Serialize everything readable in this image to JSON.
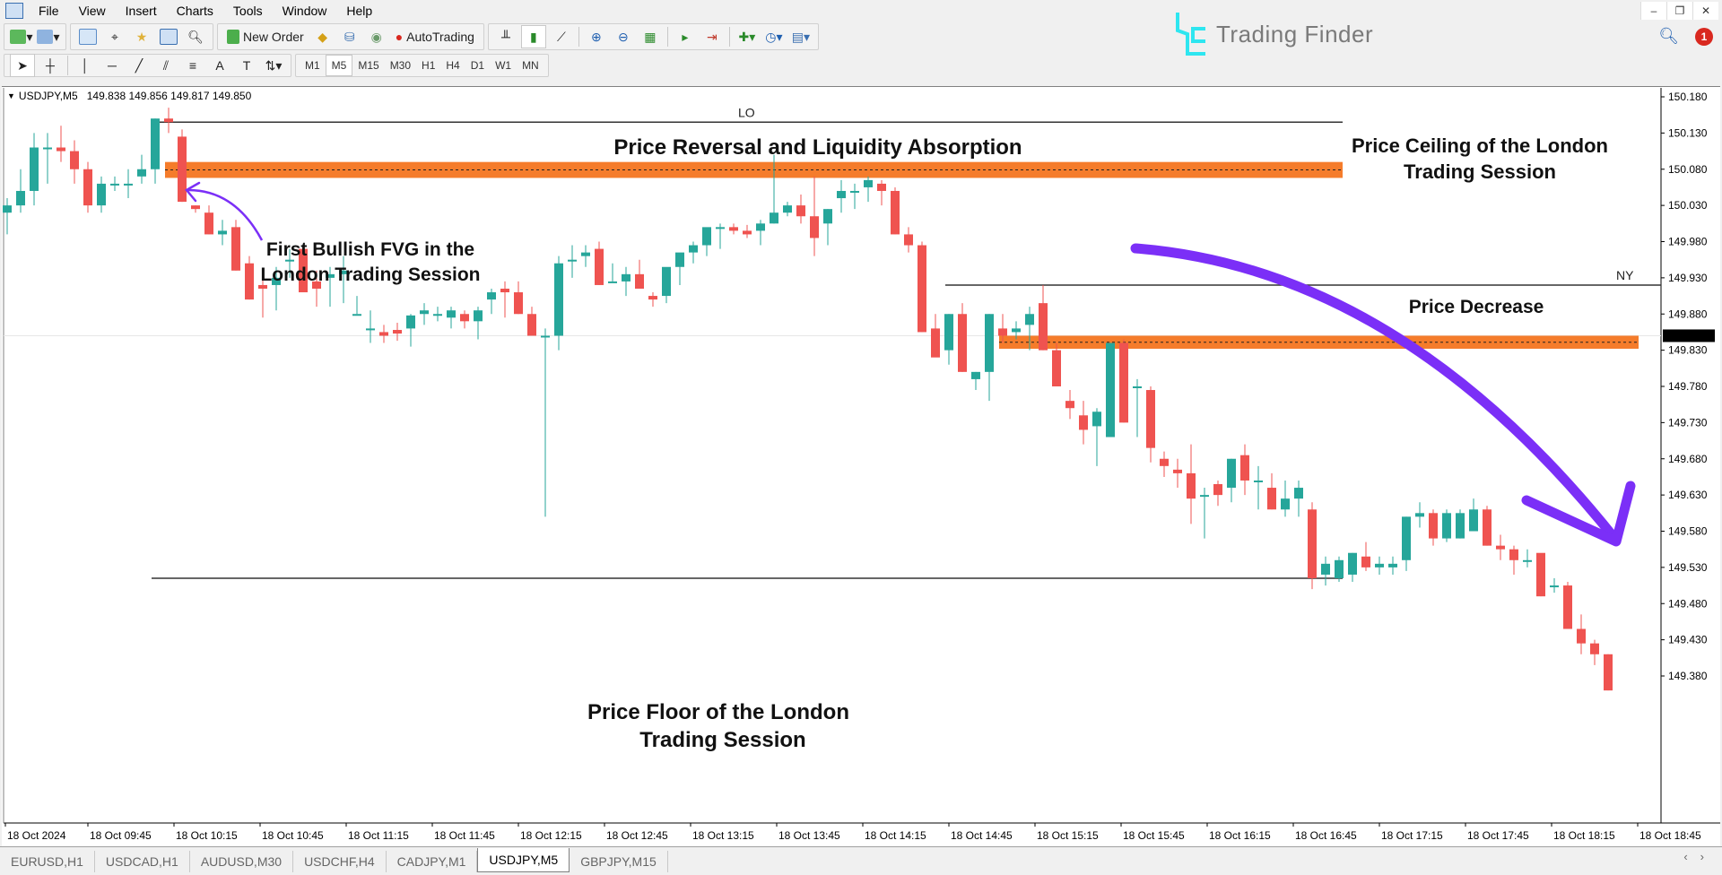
{
  "menu": {
    "items": [
      "File",
      "View",
      "Insert",
      "Charts",
      "Tools",
      "Window",
      "Help"
    ]
  },
  "window_controls": [
    "minimize-icon",
    "restore-icon",
    "close-icon"
  ],
  "toolbar": {
    "new_order_label": "New Order",
    "autotrading_label": "AutoTrading",
    "icons": [
      "new-chart-icon",
      "profiles-icon",
      "market-watch-icon",
      "data-window-icon",
      "navigator-icon",
      "terminal-icon",
      "strategy-tester-icon",
      "new-order-icon",
      "metaeditor-icon",
      "signals-icon",
      "vps-icon",
      "autotrading-icon",
      "bar-chart-icon",
      "candlestick-icon",
      "line-chart-icon",
      "zoom-in-icon",
      "zoom-out-icon",
      "tile-windows-icon",
      "auto-scroll-icon",
      "chart-shift-icon",
      "indicators-icon",
      "periods-icon",
      "templates-icon"
    ]
  },
  "drawing_toolbar": {
    "tools": [
      "cursor-icon",
      "crosshair-icon",
      "vertical-line-icon",
      "horizontal-line-icon",
      "trendline-icon",
      "equidistant-channel-icon",
      "fibonacci-icon",
      "text-icon",
      "text-label-icon",
      "arrows-icon"
    ],
    "timeframes": [
      "M1",
      "M5",
      "M15",
      "M30",
      "H1",
      "H4",
      "D1",
      "W1",
      "MN"
    ],
    "active_timeframe": "M5"
  },
  "branding": {
    "logo_text": "Trading Finder"
  },
  "notifications": {
    "count": "1"
  },
  "chart_header": {
    "symbol": "USDJPY,M5",
    "ohlc": "149.838 149.856 149.817 149.850"
  },
  "tabs": [
    {
      "label": "EURUSD,H1",
      "active": false
    },
    {
      "label": "USDCAD,H1",
      "active": false
    },
    {
      "label": "AUDUSD,M30",
      "active": false
    },
    {
      "label": "USDCHF,H4",
      "active": false
    },
    {
      "label": "CADJPY,M1",
      "active": false
    },
    {
      "label": "USDJPY,M5",
      "active": true
    },
    {
      "label": "GBPJPY,M15",
      "active": false
    }
  ],
  "colors": {
    "bull": "#26a69a",
    "bear": "#ef5350",
    "fvg_zone": "#f57c2b",
    "arrow": "#7b2ff7",
    "session_line": "#333333"
  },
  "chart_data": {
    "type": "candlestick",
    "symbol": "USDJPY",
    "timeframe": "M5",
    "ylim": [
      149.36,
      150.195
    ],
    "y_ticks": [
      "150.180",
      "150.130",
      "150.080",
      "150.030",
      "149.980",
      "149.930",
      "149.880",
      "149.830",
      "149.780",
      "149.730",
      "149.680",
      "149.630",
      "149.580",
      "149.530",
      "149.480",
      "149.430",
      "149.380"
    ],
    "current_price": "149.850",
    "x_ticks": [
      "18 Oct 2024",
      "18 Oct 09:45",
      "18 Oct 10:15",
      "18 Oct 10:45",
      "18 Oct 11:15",
      "18 Oct 11:45",
      "18 Oct 12:15",
      "18 Oct 12:45",
      "18 Oct 13:15",
      "18 Oct 13:45",
      "18 Oct 14:15",
      "18 Oct 14:45",
      "18 Oct 15:15",
      "18 Oct 15:45",
      "18 Oct 16:15",
      "18 Oct 16:45",
      "18 Oct 17:15",
      "18 Oct 17:45",
      "18 Oct 18:15",
      "18 Oct 18:45"
    ],
    "candles": [
      [
        150.02,
        150.04,
        149.99,
        150.03
      ],
      [
        150.03,
        150.08,
        150.02,
        150.05
      ],
      [
        150.05,
        150.13,
        150.03,
        150.11
      ],
      [
        150.11,
        150.13,
        150.06,
        150.11
      ],
      [
        150.11,
        150.14,
        150.09,
        150.105
      ],
      [
        150.105,
        150.12,
        150.06,
        150.08
      ],
      [
        150.08,
        150.09,
        150.02,
        150.03
      ],
      [
        150.03,
        150.07,
        150.02,
        150.06
      ],
      [
        150.06,
        150.07,
        150.05,
        150.06
      ],
      [
        150.06,
        150.08,
        150.04,
        150.06
      ],
      [
        150.07,
        150.1,
        150.06,
        150.08
      ],
      [
        150.08,
        150.15,
        150.06,
        150.15
      ],
      [
        150.15,
        150.165,
        150.13,
        150.145
      ],
      [
        150.125,
        150.135,
        150.035,
        150.035
      ],
      [
        150.03,
        150.03,
        150.02,
        150.025
      ],
      [
        150.02,
        150.03,
        149.99,
        149.99
      ],
      [
        149.99,
        150.01,
        149.975,
        149.995
      ],
      [
        150.0,
        150.01,
        149.94,
        149.94
      ],
      [
        149.95,
        149.96,
        149.9,
        149.9
      ],
      [
        149.92,
        149.935,
        149.875,
        149.915
      ],
      [
        149.92,
        149.945,
        149.885,
        149.93
      ],
      [
        149.955,
        149.97,
        149.93,
        149.955
      ],
      [
        149.97,
        149.975,
        149.91,
        149.91
      ],
      [
        149.925,
        149.94,
        149.89,
        149.915
      ],
      [
        149.93,
        149.945,
        149.89,
        149.935
      ],
      [
        149.935,
        149.96,
        149.895,
        149.94
      ],
      [
        149.88,
        149.905,
        149.88,
        149.88
      ],
      [
        149.86,
        149.885,
        149.84,
        149.86
      ],
      [
        149.855,
        149.865,
        149.84,
        149.85
      ],
      [
        149.858,
        149.868,
        149.843,
        149.853
      ],
      [
        149.86,
        149.88,
        149.835,
        149.878
      ],
      [
        149.88,
        149.895,
        149.865,
        149.885
      ],
      [
        149.88,
        149.89,
        149.87,
        149.88
      ],
      [
        149.875,
        149.89,
        149.86,
        149.885
      ],
      [
        149.88,
        149.885,
        149.86,
        149.87
      ],
      [
        149.87,
        149.89,
        149.845,
        149.885
      ],
      [
        149.9,
        149.915,
        149.88,
        149.91
      ],
      [
        149.915,
        149.925,
        149.875,
        149.91
      ],
      [
        149.91,
        149.925,
        149.88,
        149.88
      ],
      [
        149.88,
        149.89,
        149.855,
        149.85
      ],
      [
        149.85,
        149.86,
        149.6,
        149.85
      ],
      [
        149.85,
        149.96,
        149.83,
        149.95
      ],
      [
        149.955,
        149.975,
        149.93,
        149.955
      ],
      [
        149.96,
        149.975,
        149.945,
        149.965
      ],
      [
        149.97,
        149.98,
        149.92,
        149.92
      ],
      [
        149.925,
        149.95,
        149.925,
        149.925
      ],
      [
        149.925,
        149.945,
        149.905,
        149.935
      ],
      [
        149.935,
        149.955,
        149.915,
        149.915
      ],
      [
        149.905,
        149.91,
        149.89,
        149.9
      ],
      [
        149.905,
        149.93,
        149.895,
        149.945
      ],
      [
        149.945,
        149.96,
        149.92,
        149.965
      ],
      [
        149.965,
        149.98,
        149.95,
        149.975
      ],
      [
        149.975,
        149.99,
        149.96,
        150.0
      ],
      [
        150.0,
        150.005,
        149.97,
        150.0
      ],
      [
        150.0,
        150.005,
        149.99,
        149.995
      ],
      [
        149.995,
        150.003,
        149.985,
        149.99
      ],
      [
        149.995,
        150.01,
        149.975,
        150.005
      ],
      [
        150.005,
        150.1,
        150.005,
        150.02
      ],
      [
        150.02,
        150.035,
        150.015,
        150.03
      ],
      [
        150.03,
        150.045,
        150.005,
        150.015
      ],
      [
        150.015,
        150.07,
        149.96,
        149.985
      ],
      [
        150.005,
        150.025,
        149.975,
        150.025
      ],
      [
        150.04,
        150.065,
        150.02,
        150.05
      ],
      [
        150.05,
        150.06,
        150.025,
        150.05
      ],
      [
        150.055,
        150.07,
        150.035,
        150.065
      ],
      [
        150.06,
        150.065,
        150.03,
        150.05
      ],
      [
        150.05,
        150.055,
        149.99,
        149.99
      ],
      [
        149.99,
        150.0,
        149.965,
        149.975
      ],
      [
        149.975,
        149.98,
        149.855,
        149.855
      ],
      [
        149.86,
        149.88,
        149.825,
        149.82
      ],
      [
        149.83,
        149.88,
        149.81,
        149.88
      ],
      [
        149.88,
        149.895,
        149.8,
        149.8
      ],
      [
        149.79,
        149.8,
        149.775,
        149.8
      ],
      [
        149.8,
        149.88,
        149.76,
        149.88
      ],
      [
        149.86,
        149.88,
        149.84,
        149.85
      ],
      [
        149.855,
        149.87,
        149.845,
        149.86
      ],
      [
        149.865,
        149.89,
        149.83,
        149.88
      ],
      [
        149.895,
        149.92,
        149.83,
        149.83
      ],
      [
        149.83,
        149.84,
        149.78,
        149.78
      ],
      [
        149.76,
        149.775,
        149.735,
        149.75
      ],
      [
        149.74,
        149.76,
        149.7,
        149.72
      ],
      [
        149.725,
        149.75,
        149.67,
        149.745
      ],
      [
        149.71,
        149.84,
        149.71,
        149.84
      ],
      [
        149.84,
        149.845,
        149.73,
        149.73
      ],
      [
        149.78,
        149.79,
        149.71,
        149.78
      ],
      [
        149.775,
        149.78,
        149.675,
        149.695
      ],
      [
        149.68,
        149.69,
        149.655,
        149.67
      ],
      [
        149.665,
        149.68,
        149.64,
        149.66
      ],
      [
        149.66,
        149.7,
        149.59,
        149.625
      ],
      [
        149.63,
        149.64,
        149.57,
        149.63
      ],
      [
        149.645,
        149.65,
        149.615,
        149.63
      ],
      [
        149.64,
        149.68,
        149.62,
        149.68
      ],
      [
        149.685,
        149.7,
        149.63,
        149.65
      ],
      [
        149.65,
        149.67,
        149.61,
        149.65
      ],
      [
        149.64,
        149.66,
        149.61,
        149.61
      ],
      [
        149.61,
        149.65,
        149.6,
        149.625
      ],
      [
        149.625,
        149.65,
        149.6,
        149.64
      ],
      [
        149.61,
        149.62,
        149.5,
        149.515
      ],
      [
        149.52,
        149.545,
        149.505,
        149.535
      ],
      [
        149.515,
        149.545,
        149.51,
        149.54
      ],
      [
        149.52,
        149.55,
        149.51,
        149.55
      ],
      [
        149.545,
        149.565,
        149.525,
        149.53
      ],
      [
        149.53,
        149.545,
        149.52,
        149.535
      ],
      [
        149.53,
        149.545,
        149.52,
        149.535
      ],
      [
        149.54,
        149.6,
        149.525,
        149.6
      ],
      [
        149.6,
        149.62,
        149.585,
        149.605
      ],
      [
        149.605,
        149.61,
        149.56,
        149.57
      ],
      [
        149.57,
        149.61,
        149.565,
        149.605
      ],
      [
        149.57,
        149.61,
        149.57,
        149.605
      ],
      [
        149.58,
        149.625,
        149.58,
        149.61
      ],
      [
        149.61,
        149.615,
        149.56,
        149.56
      ],
      [
        149.56,
        149.575,
        149.54,
        149.555
      ],
      [
        149.555,
        149.56,
        149.52,
        149.54
      ],
      [
        149.54,
        149.555,
        149.53,
        149.54
      ],
      [
        149.55,
        149.545,
        149.49,
        149.49
      ],
      [
        149.505,
        149.515,
        149.495,
        149.505
      ],
      [
        149.505,
        149.51,
        149.445,
        149.445
      ],
      [
        149.445,
        149.465,
        149.41,
        149.425
      ],
      [
        149.425,
        149.43,
        149.395,
        149.41
      ],
      [
        149.41,
        149.41,
        149.36,
        149.36
      ]
    ],
    "sessions": [
      {
        "label": "LO",
        "level": 150.145,
        "start_index": 11,
        "end_index": 99
      },
      {
        "label": "NY",
        "level": 149.92,
        "start_index": 70,
        "end_index": 119
      }
    ],
    "session_floor": {
      "level": 149.515,
      "start_index": 11,
      "end_index": 99
    },
    "fvg_zones": [
      {
        "top": 150.09,
        "bottom": 150.068,
        "mid": 150.079,
        "start_index": 12,
        "end_index": 99
      },
      {
        "top": 149.85,
        "bottom": 149.832,
        "mid": 149.841,
        "start_index": 74,
        "end_index": 121
      }
    ],
    "annotations": [
      {
        "text": "Price Reversal and Liquidity Absorption"
      },
      {
        "text": "Price Ceiling of the London",
        "text2": "Trading Session"
      },
      {
        "text": "First Bullish FVG in the",
        "text2": "London Trading Session"
      },
      {
        "text": "Price Decrease"
      },
      {
        "text": "Price Floor of the London",
        "text2": "Trading Session"
      }
    ]
  }
}
